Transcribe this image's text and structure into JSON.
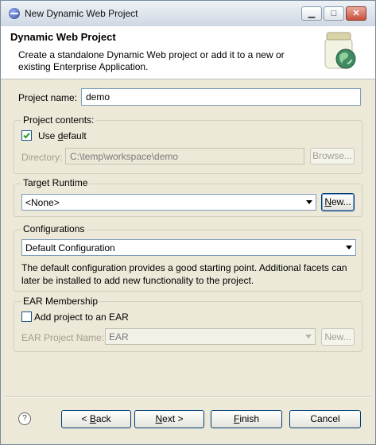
{
  "titlebar": {
    "title": "New Dynamic Web Project",
    "minimize": "▁",
    "maximize": "□",
    "close": "✕"
  },
  "banner": {
    "title": "Dynamic Web Project",
    "description": "Create a standalone Dynamic Web project or add it to a new or existing Enterprise Application."
  },
  "project_name": {
    "label": "Project name:",
    "value": "demo"
  },
  "project_contents": {
    "legend": "Project contents:",
    "use_default_prefix": "Use ",
    "use_default_mnemonic": "d",
    "use_default_suffix": "efault",
    "use_default_checked": true,
    "directory_label": "Directory:",
    "directory_value": "C:\\temp\\workspace\\demo",
    "browse_label": "Browse..."
  },
  "target_runtime": {
    "legend": "Target Runtime",
    "selected": "<None>",
    "new_prefix": "",
    "new_mnemonic": "N",
    "new_suffix": "ew..."
  },
  "configurations": {
    "legend": "Configurations",
    "selected": "Default Configuration",
    "description": "The default configuration provides a good starting point. Additional facets can later be installed to add new functionality to the project."
  },
  "ear_membership": {
    "legend": "EAR Membership",
    "add_label": "Add project to an EAR",
    "add_checked": false,
    "ear_project_label": "EAR Project Name:",
    "ear_project_value": "EAR",
    "new_label": "New..."
  },
  "footer": {
    "help": "?",
    "back_prefix": "< ",
    "back_mnemonic": "B",
    "back_suffix": "ack",
    "next_mnemonic": "N",
    "next_suffix": "ext >",
    "finish_mnemonic": "F",
    "finish_suffix": "inish",
    "cancel": "Cancel"
  }
}
